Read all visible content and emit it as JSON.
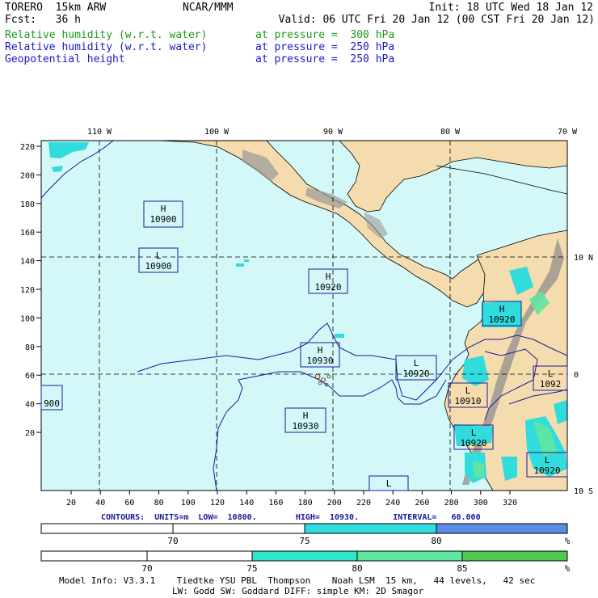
{
  "header": {
    "model_name": "TORERO  15km ARW",
    "org": "NCAR/MMM",
    "init": "Init: 18 UTC Wed 18 Jan 12",
    "fcst": "Fcst:   36 h",
    "valid": "Valid: 06 UTC Fri 20 Jan 12 (00 CST Fri 20 Jan 12)",
    "fields": [
      {
        "name": "Relative humidity (w.r.t. water)",
        "level": "at pressure =  300 hPa",
        "color": "#1a9a1a"
      },
      {
        "name": "Relative humidity (w.r.t. water)",
        "level": "at pressure =  250 hPa",
        "color": "#1a1acc"
      },
      {
        "name": "Geopotential height",
        "level": "at pressure =  250 hPa",
        "color": "#1a1acc"
      }
    ]
  },
  "map": {
    "top_lon_labels": [
      "110 W",
      "100 W",
      "90 W",
      "80 W",
      "70 W"
    ],
    "right_lat_labels": [
      "10 N",
      "0",
      "10 S"
    ],
    "left_y_ticks": [
      "220",
      "200",
      "180",
      "160",
      "140",
      "120",
      "100",
      "80",
      "60",
      "40",
      "20"
    ],
    "bottom_x_ticks": [
      "20",
      "40",
      "60",
      "80",
      "100",
      "120",
      "140",
      "160",
      "180",
      "200",
      "220",
      "240",
      "260",
      "280",
      "300",
      "320"
    ],
    "ocean_color": "#d4f8f8",
    "land_color": "#f5dcae",
    "pressure_centers": [
      {
        "type": "H",
        "value": "10900"
      },
      {
        "type": "L",
        "value": "10900"
      },
      {
        "type": "H",
        "value": "10920"
      },
      {
        "type": "H",
        "value": "10920"
      },
      {
        "type": "H",
        "value": "10930"
      },
      {
        "type": "L",
        "value": "10920"
      },
      {
        "type": "L",
        "value": "10910"
      },
      {
        "type": "L",
        "value": "1092"
      },
      {
        "type": "L",
        "value": "10920"
      },
      {
        "type": "H",
        "value": "10930"
      },
      {
        "type": "L",
        "value": "10920"
      },
      {
        "type": "",
        "value": "900"
      },
      {
        "type": "L",
        "value": ""
      }
    ]
  },
  "contours_info": "CONTOURS:  UNITS=m  LOW=  10800.        HIGH=  10930.       INTERVAL=   60.000",
  "colorbars": [
    {
      "labels": [
        "70",
        "75",
        "80"
      ],
      "unit": "%",
      "colors": [
        "#ffffff",
        "#30dcdc",
        "#5a8ce6"
      ]
    },
    {
      "labels": [
        "70",
        "75",
        "80",
        "85"
      ],
      "unit": "%",
      "colors": [
        "#ffffff",
        "#30e6c8",
        "#60e6a0",
        "#50c850"
      ]
    }
  ],
  "footer": {
    "line1": "Model Info: V3.3.1    Tiedtke YSU PBL  Thompson    Noah LSM  15 km,   44 levels,   42 sec",
    "line2": "LW: Godd SW: Goddard DIFF: simple KM: 2D Smagor"
  }
}
